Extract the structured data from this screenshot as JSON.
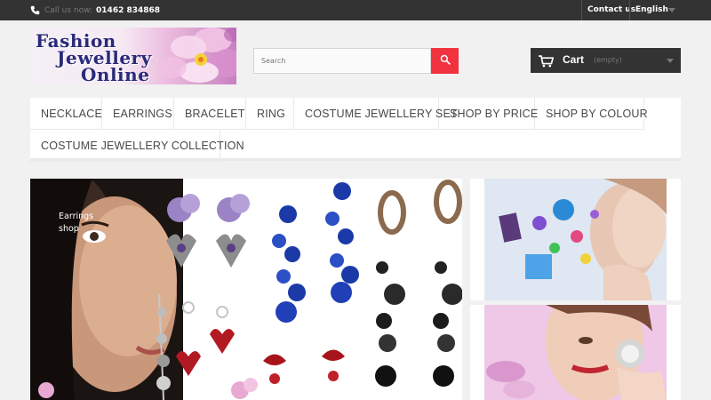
{
  "topbar": {
    "call_label": "Call us now:",
    "phone": "01462 834868",
    "contact_label": "Contact us",
    "language": "English"
  },
  "logo": {
    "line1": "Fashion",
    "line2": "Jewellery",
    "line3": "Online"
  },
  "search": {
    "placeholder": "Search"
  },
  "cart": {
    "label": "Cart",
    "status": "(empty)"
  },
  "menu": {
    "items": [
      "NECKLACE",
      "EARRINGS",
      "BRACELET",
      "RING",
      "COSTUME JEWELLERY SET",
      "SHOP BY PRICE",
      "SHOP BY COLOUR",
      "COSTUME JEWELLERY COLLECTION"
    ]
  },
  "banner": {
    "caption": "Earrings shop"
  },
  "colors": {
    "topbar": "#333333",
    "accent": "#f13340",
    "background": "#f1f1f1"
  },
  "icons": {
    "phone": "phone-icon",
    "search": "search-icon",
    "cart": "cart-icon",
    "caret": "chevron-down-icon"
  }
}
